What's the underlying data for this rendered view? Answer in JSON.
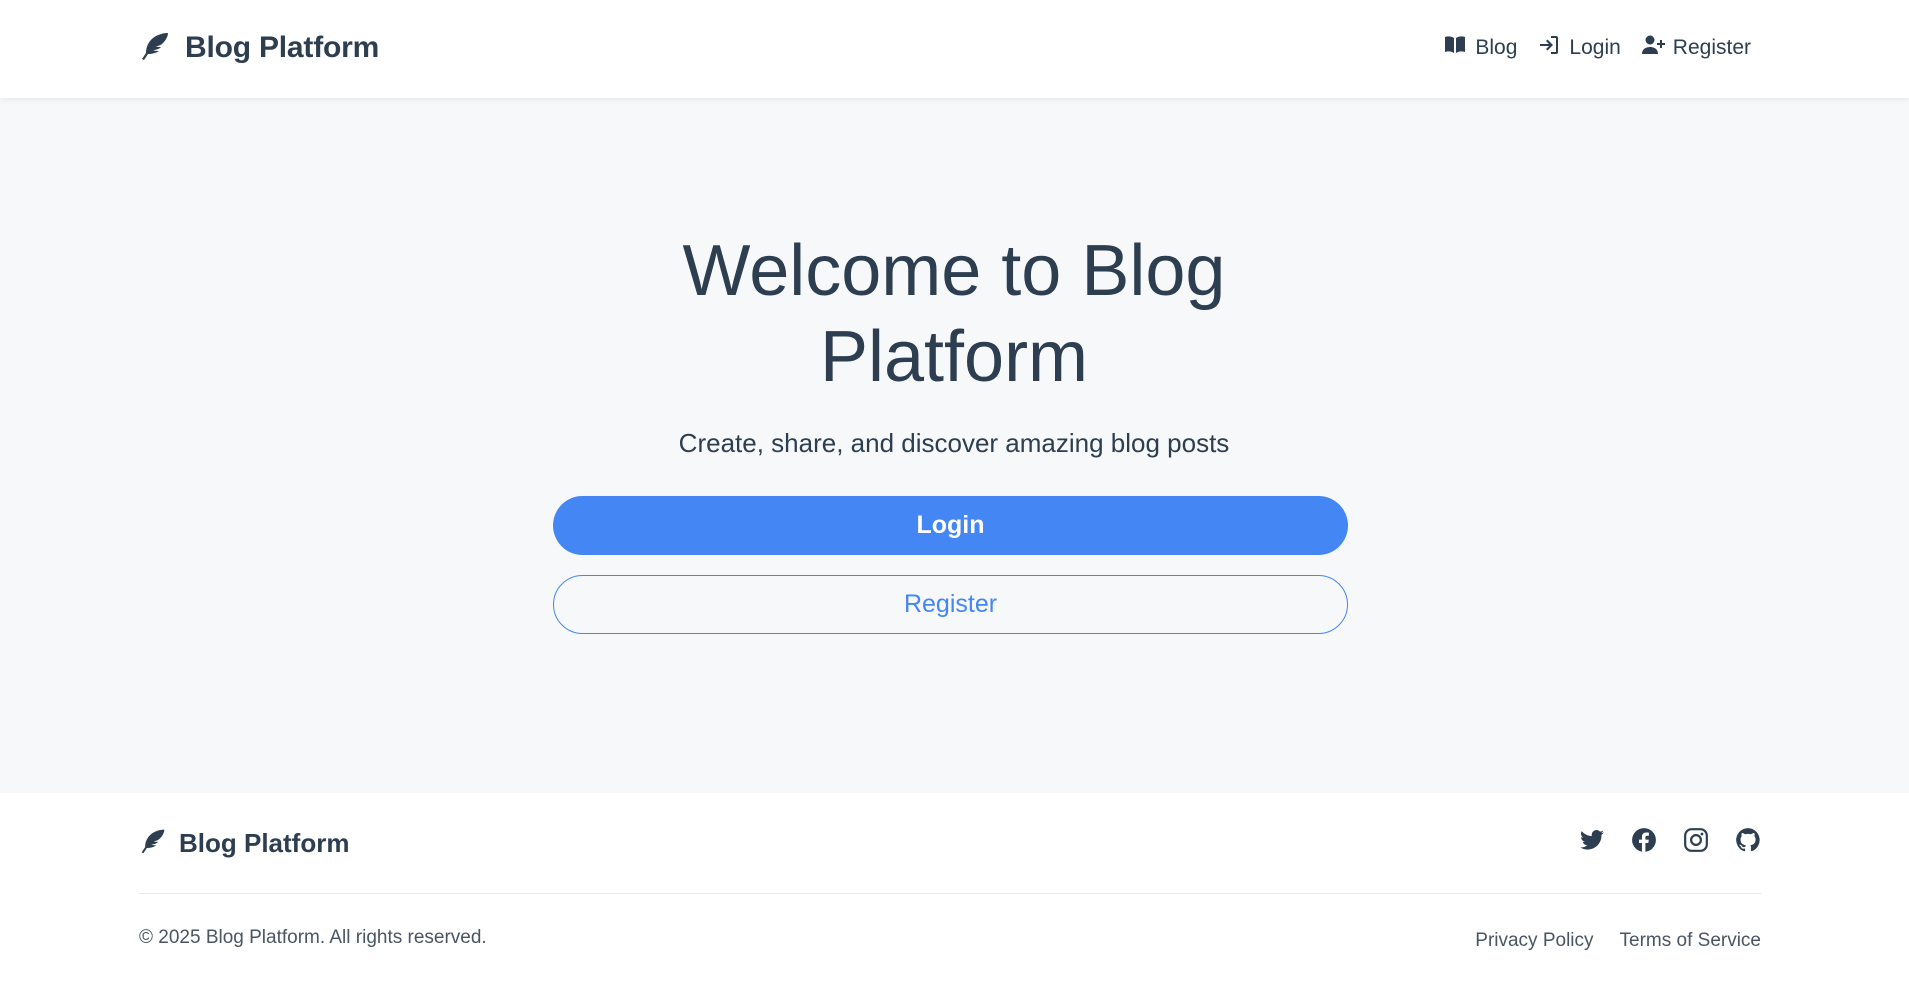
{
  "header": {
    "brand": "Blog Platform",
    "brand_icon": "feather-icon",
    "nav": [
      {
        "label": "Blog",
        "icon": "book-icon"
      },
      {
        "label": "Login",
        "icon": "login-icon"
      },
      {
        "label": "Register",
        "icon": "user-plus-icon"
      }
    ]
  },
  "hero": {
    "title": "Welcome to Blog Platform",
    "subtitle": "Create, share, and discover amazing blog posts",
    "login_label": "Login",
    "register_label": "Register"
  },
  "footer": {
    "brand": "Blog Platform",
    "social": [
      "twitter-icon",
      "facebook-icon",
      "instagram-icon",
      "github-icon"
    ],
    "copyright": "© 2025 Blog Platform. All rights reserved.",
    "links": [
      "Privacy Policy",
      "Terms of Service"
    ]
  },
  "colors": {
    "primary": "#4386f4",
    "text": "#2c3e50",
    "background": "#f7f8fa"
  }
}
